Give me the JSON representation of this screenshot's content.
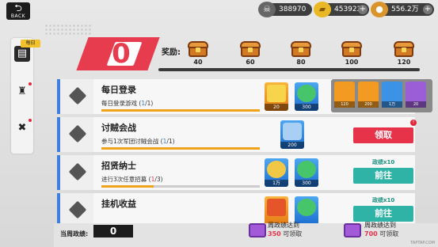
{
  "topbar": {
    "back_label": "BACK",
    "resources": [
      {
        "icon": "skull-icon",
        "value": "388970"
      },
      {
        "icon": "gold-ingot-icon",
        "value": "453922"
      },
      {
        "icon": "coin-icon",
        "value": "556.2万"
      }
    ]
  },
  "sidenav": {
    "tag": "每日",
    "items": [
      {
        "icon": "clipboard-icon",
        "active": true
      },
      {
        "icon": "trophy-icon",
        "active": false
      },
      {
        "icon": "swords-icon",
        "active": false
      }
    ]
  },
  "header": {
    "score": "0",
    "reward_label": "奖励:",
    "milestones": [
      "40",
      "60",
      "80",
      "100",
      "120"
    ]
  },
  "reward_preview": {
    "items": [
      {
        "count": "120",
        "color": "orange"
      },
      {
        "count": "200",
        "color": "orange"
      },
      {
        "count": "1万",
        "color": "blue"
      },
      {
        "count": "20",
        "color": "purple"
      }
    ]
  },
  "tasks": [
    {
      "title": "每日登录",
      "desc_prefix": "每日登录游戏 (",
      "progress_done": "1",
      "progress_sep": "/1)",
      "progress_fraction": 1.0,
      "rewards": [
        {
          "icon": "gold-ingot-icon",
          "count": "20",
          "bg": "orange"
        },
        {
          "icon": "green-token-icon",
          "count": "300",
          "bg": "blue"
        }
      ],
      "button": null,
      "caption": null
    },
    {
      "title": "讨贼会战",
      "desc_prefix": "参与1次军团讨贼会战 (",
      "progress_done": "1",
      "progress_sep": "/1)",
      "progress_fraction": 1.0,
      "rewards": [
        {
          "icon": "gear-icon",
          "count": "200",
          "bg": "blue"
        }
      ],
      "button": "领取",
      "caption": null,
      "badge": "!"
    },
    {
      "title": "招贤纳士",
      "desc_prefix": "进行3次任意招募 (",
      "progress_done": "1",
      "progress_sep": "/3)",
      "progress_fraction": 0.33,
      "rewards": [
        {
          "icon": "copper-coin-icon",
          "count": "1万",
          "bg": "blue"
        },
        {
          "icon": "green-token-icon",
          "count": "300",
          "bg": "blue"
        }
      ],
      "button": "前往",
      "caption": "政绩x10"
    },
    {
      "title": "挂机收益",
      "desc_prefix": "",
      "progress_done": "",
      "progress_sep": "",
      "progress_fraction": 0,
      "rewards": [
        {
          "icon": "fire-icon",
          "count": "",
          "bg": "orange"
        },
        {
          "icon": "green-token-icon",
          "count": "",
          "bg": "blue"
        }
      ],
      "button": "前往",
      "caption": "政绩x10"
    }
  ],
  "bottom": {
    "week_label": "当周政绩:",
    "week_value": "0",
    "claims": [
      {
        "line1": "周政绩达到",
        "value": "350",
        "suffix": "可领取"
      },
      {
        "line1": "周政绩达到",
        "value": "700",
        "suffix": "可领取"
      }
    ],
    "footer_mark": "TAPTAP.COM"
  }
}
